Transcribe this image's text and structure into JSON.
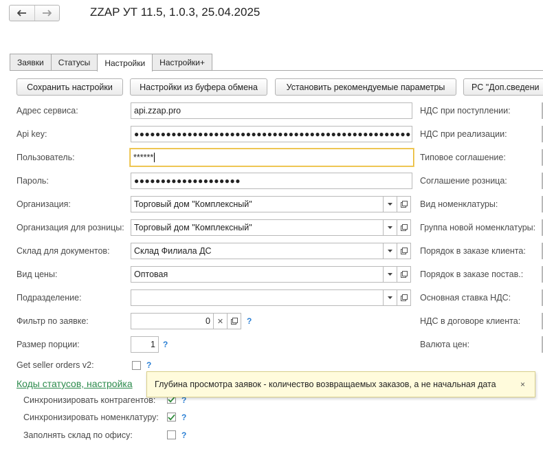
{
  "window": {
    "title": "ZZAP УТ 11.5, 1.0.3, 25.04.2025"
  },
  "tabs": [
    "Заявки",
    "Статусы",
    "Настройки",
    "Настройки+"
  ],
  "toolbar": {
    "save": "Сохранить настройки",
    "from_clipboard": "Настройки из буфера обмена",
    "recommended": "Установить рекомендуемые параметры",
    "extra": "РС \"Доп.сведени"
  },
  "form": {
    "service_address": {
      "label": "Адрес сервиса:",
      "value": "api.zzap.pro"
    },
    "api_key": {
      "label": "Api key:",
      "value": "●●●●●●●●●●●●●●●●●●●●●●●●●●●●●●●●●●●●●●●●●●●●●●●●●●●●●●"
    },
    "user": {
      "label": "Пользователь:",
      "value": "******"
    },
    "password": {
      "label": "Пароль:",
      "value": "●●●●●●●●●●●●●●●●●●●●"
    },
    "organization": {
      "label": "Организация:",
      "value": "Торговый дом \"Комплексный\""
    },
    "retail_org": {
      "label": "Организация для розницы:",
      "value": "Торговый дом \"Комплексный\""
    },
    "warehouse": {
      "label": "Склад для документов:",
      "value": "Склад Филиала ДС"
    },
    "price_type": {
      "label": "Вид цены:",
      "value": "Оптовая"
    },
    "department": {
      "label": "Подразделение:",
      "value": ""
    },
    "order_filter": {
      "label": "Фильтр по заявке:",
      "value": "0"
    },
    "batch_size": {
      "label": "Размер порции:",
      "value": "1"
    },
    "seller_orders": {
      "label": "Get seller orders v2:"
    },
    "help_mark": "?"
  },
  "right_labels": [
    "НДС при поступлении:",
    "НДС при реализации:",
    "Типовое соглашение:",
    "Соглашение розница:",
    "Вид номенклатуры:",
    "Группа новой номенклатуры:",
    "Порядок в заказе клиента:",
    "Порядок в заказе постав.:",
    "Основная ставка НДС:",
    "НДС в договоре клиента:",
    "Валюта цен:"
  ],
  "statuses_link": "Коды статусов, настройка",
  "sync": {
    "counterparties": "Синхронизировать контрагентов:",
    "nomenclature": "Синхронизировать номенклатуру:",
    "fill_warehouse": "Заполнять склад по офису:"
  },
  "tooltip": {
    "text": "Глубина просмотра заявок - количество возвращаемых заказов, а не начальная дата",
    "close": "×"
  },
  "colors": {
    "accent_link": "#2b8a4b",
    "help": "#2a7fd4",
    "focus": "#e8b82b",
    "tooltip_bg": "#fffbdc"
  }
}
